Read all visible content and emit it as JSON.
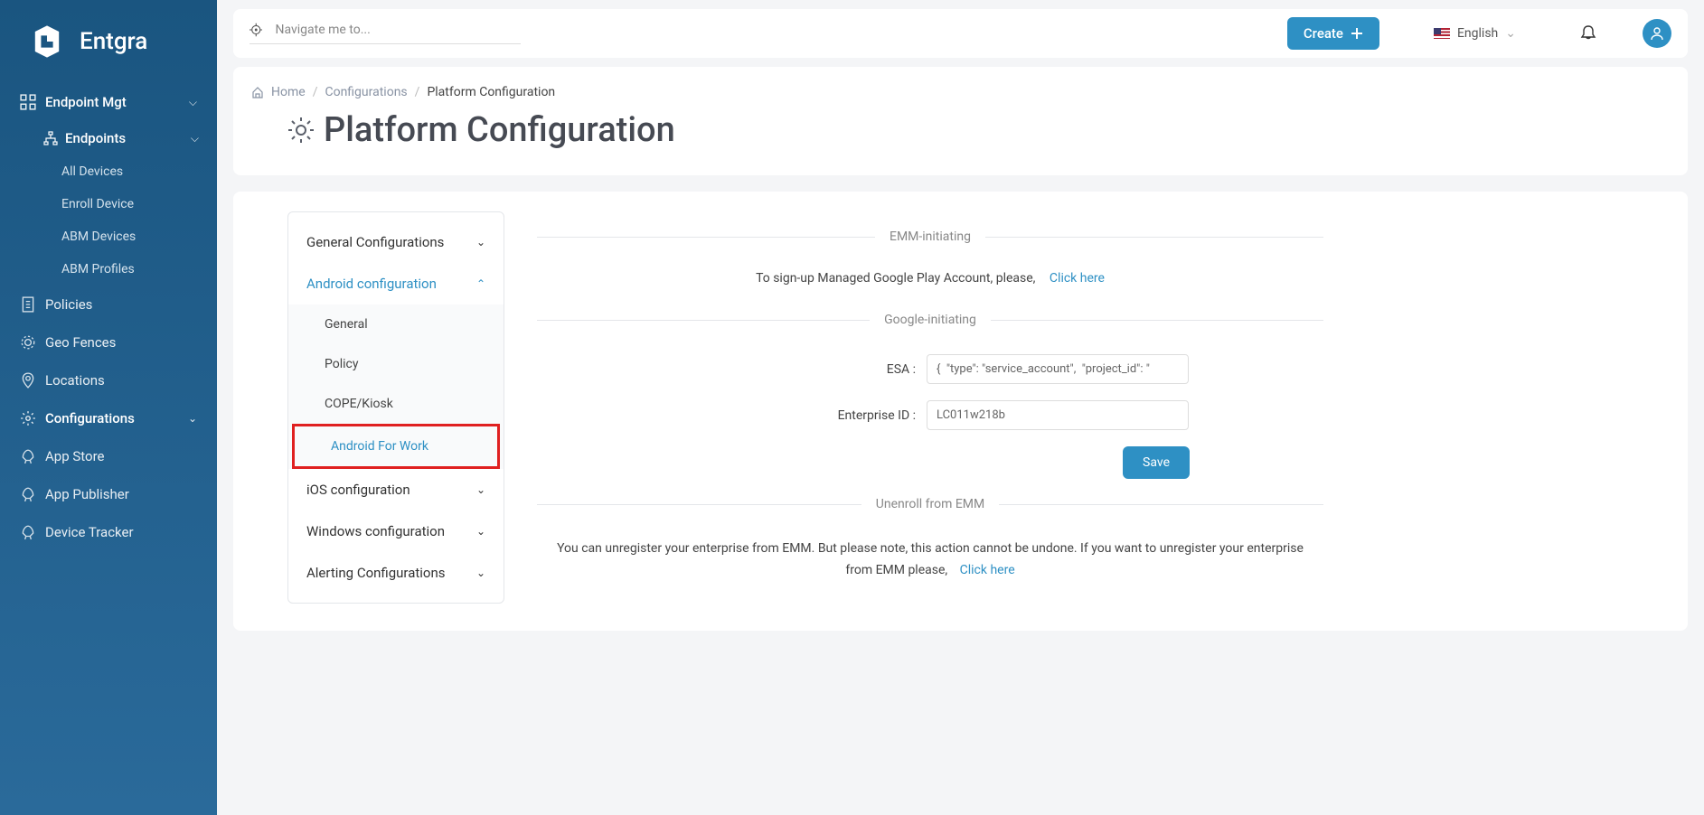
{
  "brand": {
    "name": "Entgra"
  },
  "topbar": {
    "search_placeholder": "Navigate me to...",
    "create_label": "Create",
    "language": "English"
  },
  "sidebar": {
    "section1": {
      "label": "Endpoint Mgt"
    },
    "endpoints": {
      "label": "Endpoints",
      "items": [
        {
          "label": "All Devices"
        },
        {
          "label": "Enroll Device"
        },
        {
          "label": "ABM Devices"
        },
        {
          "label": "ABM Profiles"
        }
      ]
    },
    "items": [
      {
        "label": "Policies"
      },
      {
        "label": "Geo Fences"
      },
      {
        "label": "Locations"
      }
    ],
    "section2": {
      "label": "Configurations"
    },
    "apps": [
      {
        "label": "App Store"
      },
      {
        "label": "App Publisher"
      },
      {
        "label": "Device Tracker"
      }
    ]
  },
  "breadcrumb": {
    "home": "Home",
    "l1": "Configurations",
    "l2": "Platform Configuration"
  },
  "page": {
    "title": "Platform Configuration"
  },
  "tree": {
    "items": [
      {
        "label": "General Configurations"
      },
      {
        "label": "Android configuration",
        "subs": [
          {
            "label": "General"
          },
          {
            "label": "Policy"
          },
          {
            "label": "COPE/Kiosk"
          },
          {
            "label": "Android For Work"
          }
        ]
      },
      {
        "label": "iOS configuration"
      },
      {
        "label": "Windows configuration"
      },
      {
        "label": "Alerting Configurations"
      }
    ]
  },
  "panel": {
    "emm_label": "EMM-initiating",
    "signup_text": "To sign-up Managed Google Play Account, please,",
    "click_here": "Click here",
    "google_label": "Google-initiating",
    "esa_label": "ESA :",
    "esa_value": "{  \"type\": \"service_account\",  \"project_id\": \"",
    "eid_label": "Enterprise ID :",
    "eid_value": "LC011w218b",
    "save": "Save",
    "unenroll_label": "Unenroll from EMM",
    "unenroll_text": "You can unregister your enterprise from EMM. But please note, this action cannot be undone. If you want to unregister your enterprise from EMM please,"
  }
}
